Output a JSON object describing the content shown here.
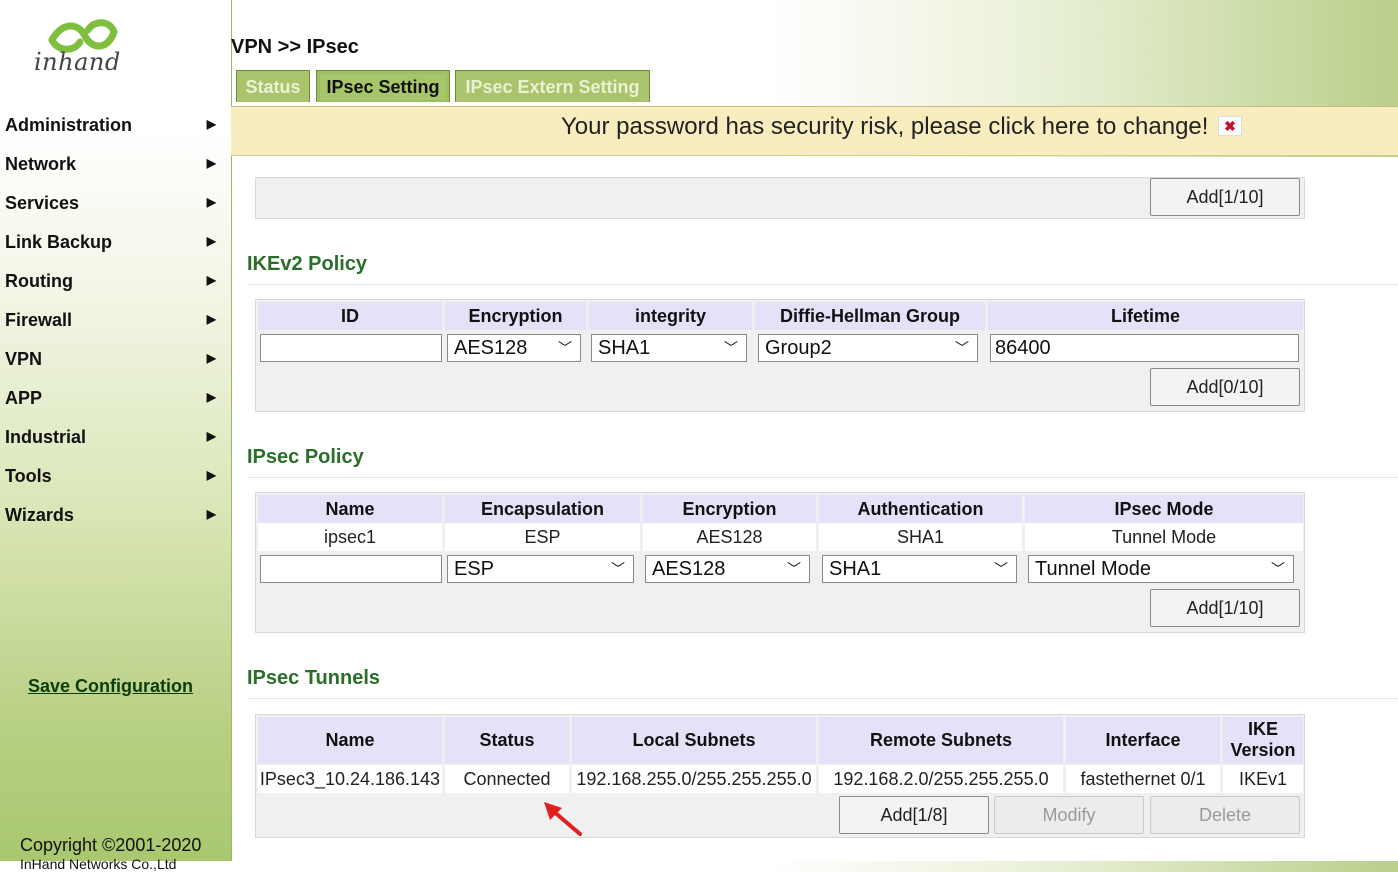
{
  "brand": {
    "logo_text": "inhand"
  },
  "sidebar": {
    "items": [
      {
        "label": "Administration"
      },
      {
        "label": "Network"
      },
      {
        "label": "Services"
      },
      {
        "label": "Link Backup"
      },
      {
        "label": "Routing"
      },
      {
        "label": "Firewall"
      },
      {
        "label": "VPN"
      },
      {
        "label": "APP"
      },
      {
        "label": "Industrial"
      },
      {
        "label": "Tools"
      },
      {
        "label": "Wizards"
      }
    ],
    "save_label": "Save Configuration",
    "copyright": "Copyright ©2001-2020",
    "copyright_line2": "InHand Networks Co.,Ltd"
  },
  "header": {
    "breadcrumb": "VPN >> IPsec",
    "tabs": [
      {
        "label": "Status"
      },
      {
        "label": "IPsec Setting"
      },
      {
        "label": "IPsec Extern Setting"
      }
    ]
  },
  "warning": {
    "text": "Your password has security risk, please click here to change!",
    "close": "✖"
  },
  "top_panel": {
    "add_label": "Add[1/10]"
  },
  "ikev2": {
    "title": "IKEv2 Policy",
    "headers": [
      "ID",
      "Encryption",
      "integrity",
      "Diffie-Hellman Group",
      "Lifetime"
    ],
    "form": {
      "id": "",
      "encryption": "AES128",
      "integrity": "SHA1",
      "dh_group": "Group2",
      "lifetime": "86400"
    },
    "add_label": "Add[0/10]"
  },
  "ipsec_policy": {
    "title": "IPsec Policy",
    "headers": [
      "Name",
      "Encapsulation",
      "Encryption",
      "Authentication",
      "IPsec Mode"
    ],
    "rows": [
      [
        "ipsec1",
        "ESP",
        "AES128",
        "SHA1",
        "Tunnel Mode"
      ]
    ],
    "form": {
      "name": "",
      "encapsulation": "ESP",
      "encryption": "AES128",
      "authentication": "SHA1",
      "mode": "Tunnel Mode"
    },
    "add_label": "Add[1/10]"
  },
  "tunnels": {
    "title": "IPsec Tunnels",
    "headers": [
      "Name",
      "Status",
      "Local Subnets",
      "Remote Subnets",
      "Interface",
      "IKE Version"
    ],
    "rows": [
      [
        "IPsec3_10.24.186.143",
        "Connected",
        "192.168.255.0/255.255.255.0",
        "192.168.2.0/255.255.255.0",
        "fastethernet 0/1",
        "IKEv1"
      ]
    ],
    "add_label": "Add[1/8]",
    "modify_label": "Modify",
    "delete_label": "Delete"
  },
  "colors": {
    "accent_green": "#2a6e2a",
    "header_bg": "#e3e2f8",
    "warning_bg": "#f7edbe",
    "annotation_arrow": "#e02020"
  }
}
